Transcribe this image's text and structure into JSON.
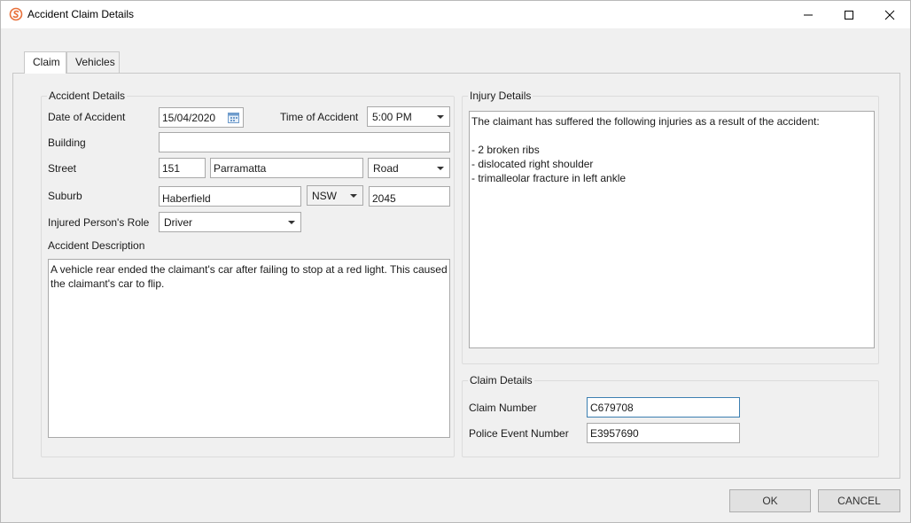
{
  "window": {
    "title": "Accident Claim Details"
  },
  "tabs": [
    {
      "label": "Claim",
      "active": true
    },
    {
      "label": "Vehicles",
      "active": false
    }
  ],
  "accident": {
    "section_title": "Accident Details",
    "date_label": "Date of Accident",
    "date_value": "15/04/2020",
    "time_label": "Time of Accident",
    "time_value": "5:00 PM",
    "building_label": "Building",
    "building_value": "",
    "street_label": "Street",
    "street_number": "151",
    "street_name": "Parramatta",
    "street_type": "Road",
    "suburb_label": "Suburb",
    "suburb_value": "Haberfield",
    "state_value": "NSW",
    "postcode_value": "2045",
    "role_label": "Injured Person's Role",
    "role_value": "Driver",
    "description_label": "Accident Description",
    "description_value": "A vehicle rear ended the claimant's car after failing to stop at a red light. This caused the claimant's car to flip."
  },
  "injury": {
    "section_title": "Injury Details",
    "text": "The claimant has suffered the following injuries as a result of the accident:\n\n- 2 broken ribs\n- dislocated right shoulder\n- trimalleolar fracture in left ankle"
  },
  "claim": {
    "section_title": "Claim Details",
    "number_label": "Claim Number",
    "number_value": "C679708",
    "police_label": "Police Event Number",
    "police_value": "E3957690"
  },
  "buttons": {
    "ok": "OK",
    "cancel": "CANCEL"
  },
  "colors": {
    "accent_icon": "#e8703a",
    "focus_border": "#3c7fb1"
  }
}
